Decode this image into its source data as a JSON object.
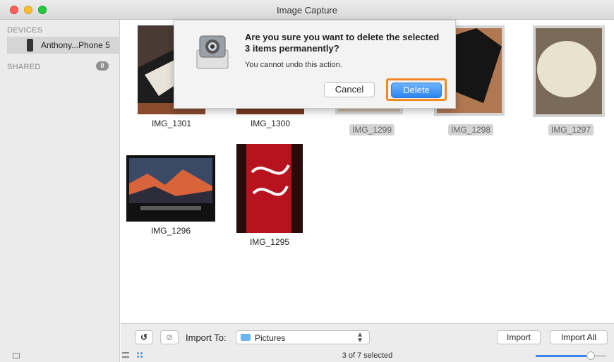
{
  "window": {
    "title": "Image Capture"
  },
  "sidebar": {
    "devices_heading": "DEVICES",
    "device_name": "Anthony...Phone 5",
    "shared_heading": "SHARED",
    "shared_count": "0"
  },
  "photos": [
    {
      "label": "IMG_1301",
      "selected": false
    },
    {
      "label": "IMG_1300",
      "selected": false
    },
    {
      "label": "IMG_1299",
      "selected": true
    },
    {
      "label": "IMG_1298",
      "selected": true
    },
    {
      "label": "IMG_1297",
      "selected": true
    },
    {
      "label": "IMG_1296",
      "selected": false
    },
    {
      "label": "IMG_1295",
      "selected": false
    }
  ],
  "dialog": {
    "title": "Are you sure you want to delete the selected 3 items permanently?",
    "message": "You cannot undo this action.",
    "cancel_label": "Cancel",
    "delete_label": "Delete"
  },
  "toolbar": {
    "import_to_label": "Import To:",
    "destination": "Pictures",
    "import_label": "Import",
    "import_all_label": "Import All"
  },
  "status": {
    "selection_text": "3 of 7 selected",
    "zoom_fraction": 0.78
  },
  "colors": {
    "accent": "#2e84ef",
    "highlight_outline": "#f08a24"
  }
}
